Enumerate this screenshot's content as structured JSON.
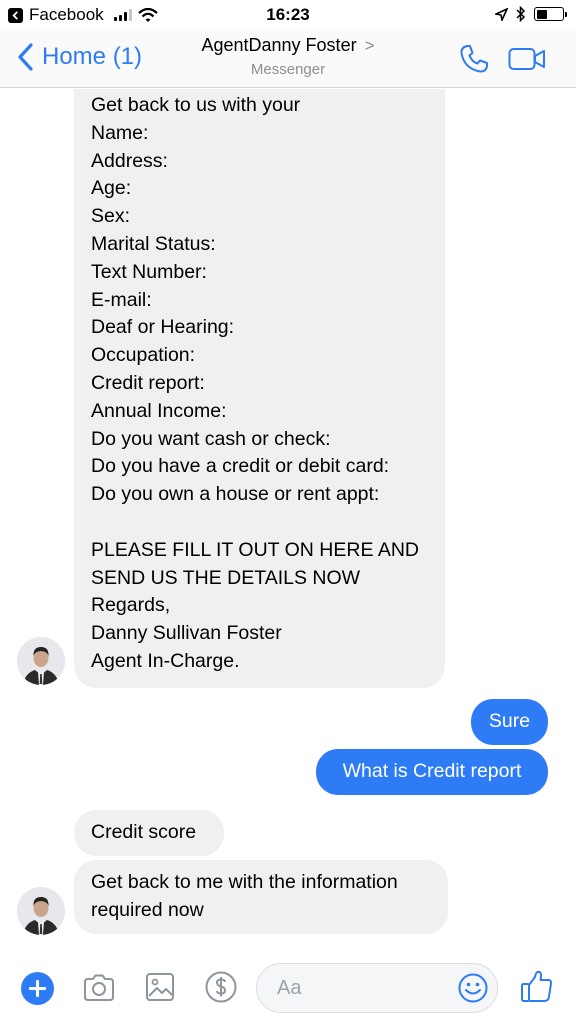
{
  "status_bar": {
    "back_app": "Facebook",
    "time": "16:23",
    "battery_level": 0.42
  },
  "nav": {
    "back_label": "Home (1)",
    "contact_name": "AgentDanny Foster",
    "chevron": ">",
    "subtitle": "Messenger"
  },
  "messages": {
    "long_message_lines": [
      "Get back to us with your",
      "Name:",
      "Address:",
      "Age:",
      "Sex:",
      "Marital Status:",
      "Text Number:",
      "E-mail:",
      "Deaf or Hearing:",
      "Occupation:",
      "Credit report:",
      "Annual Income:",
      "Do you want cash or check:",
      "Do you have a credit or debit card:",
      "Do you own a house or rent appt:",
      "",
      "PLEASE FILL IT OUT ON HERE AND",
      "SEND US THE DETAILS NOW",
      "Regards,",
      "Danny Sullivan Foster",
      "Agent In-Charge."
    ],
    "reply_1": "Sure",
    "reply_2": "What is Credit report",
    "incoming_1": "Credit score",
    "incoming_2_line_1": "Get back to me with the information",
    "incoming_2_line_2": "required now"
  },
  "composer": {
    "placeholder": "Aa",
    "icons": [
      "plus-icon",
      "camera-icon",
      "photo-icon",
      "payment-icon",
      "emoji-icon",
      "thumbs-up-icon"
    ]
  },
  "colors": {
    "accent": "#2d7cf6",
    "incoming_bubble": "#f1f0f0",
    "secondary_text": "#8e8e93"
  }
}
